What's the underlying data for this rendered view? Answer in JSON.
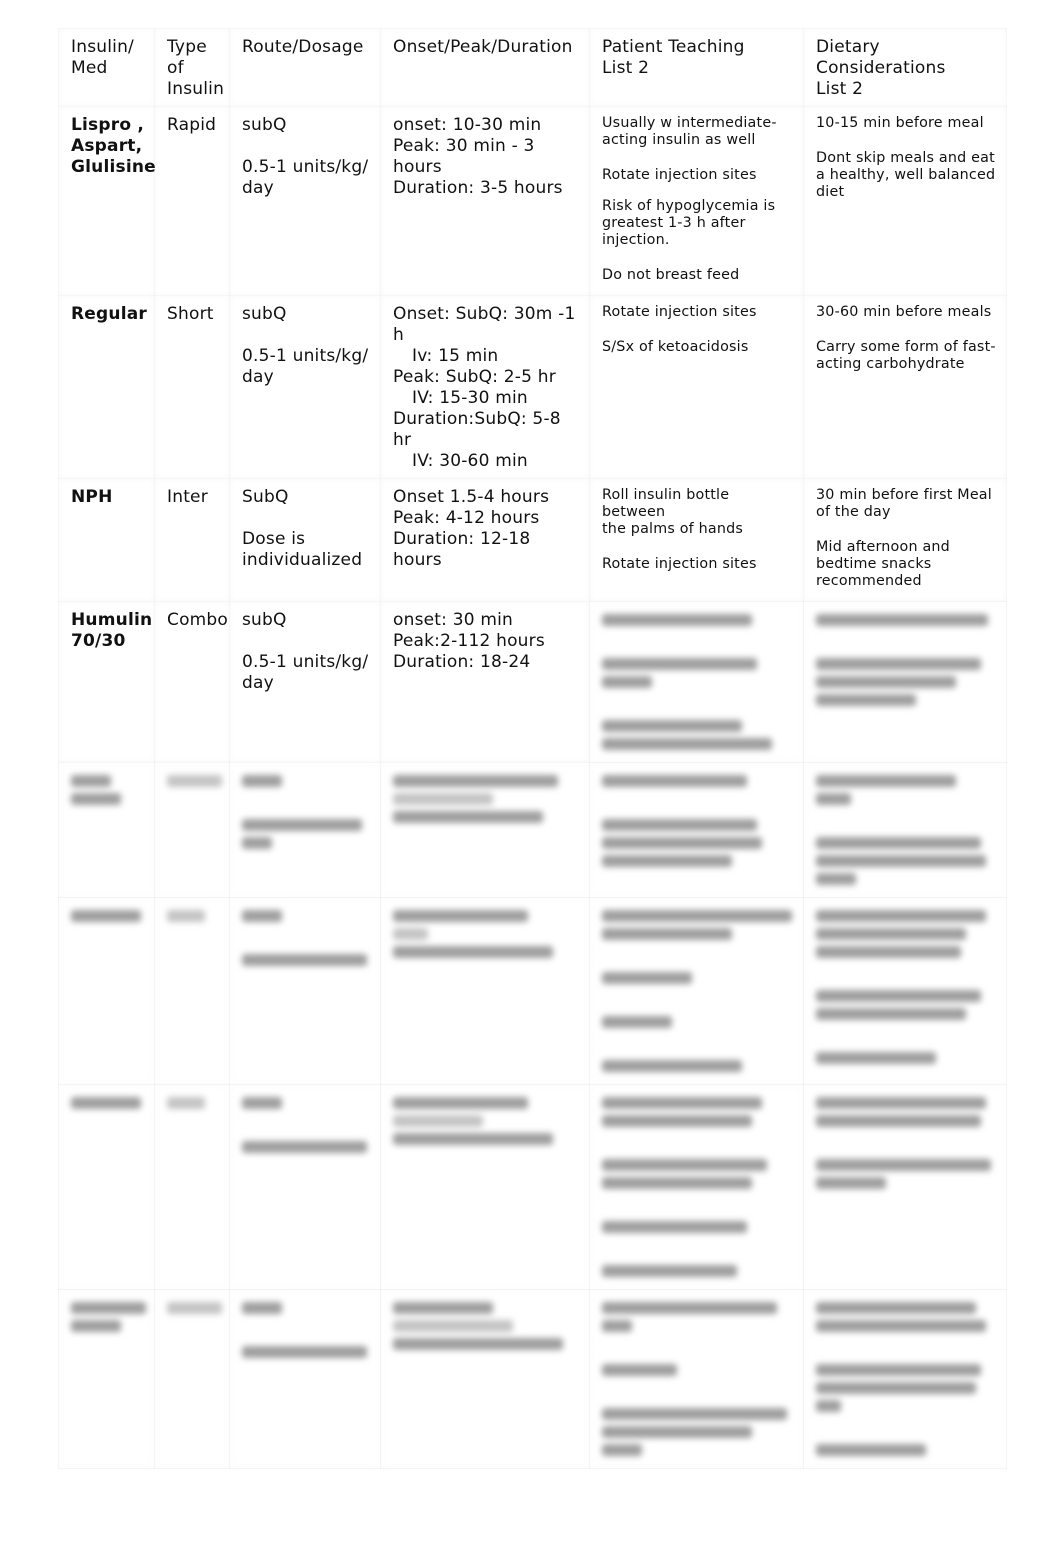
{
  "table": {
    "headers": {
      "col1": [
        "Insulin/",
        "Med"
      ],
      "col2": [
        "Type",
        "of",
        "Insulin"
      ],
      "col3": "Route/Dosage",
      "col4": "Onset/Peak/Duration",
      "col5": [
        "Patient Teaching",
        "List 2"
      ],
      "col6": [
        "Dietary",
        "Considerations",
        "List 2"
      ]
    },
    "rows": [
      {
        "med": [
          "Lispro ,",
          "Aspart,",
          "Glulisine"
        ],
        "type": "Rapid",
        "route": "subQ",
        "dosage": [
          "0.5-1 units/kg/",
          "day"
        ],
        "timing": [
          "onset: 10-30 min",
          "Peak: 30 min - 3 hours",
          "Duration: 3-5 hours"
        ],
        "teaching": [
          [
            "Usually w intermediate-",
            "acting insulin as well"
          ],
          [
            "Rotate injection sites"
          ],
          [
            "Risk of hypoglycemia is",
            "greatest 1-3 h after",
            "injection."
          ],
          [
            "Do not breast feed"
          ]
        ],
        "dietary": [
          [
            "10-15 min before meal"
          ],
          [
            "Dont skip meals and eat",
            "a healthy, well balanced",
            "diet"
          ]
        ]
      },
      {
        "med": [
          "Regular"
        ],
        "type": "Short",
        "route": "subQ",
        "dosage": [
          "0.5-1 units/kg/",
          "day"
        ],
        "timing": [
          "Onset: SubQ: 30m -1 h",
          "Iv: 15 min",
          "Peak: SubQ: 2-5 hr",
          "IV: 15-30 min",
          "Duration:SubQ: 5-8 hr",
          "IV: 30-60 min"
        ],
        "teaching": [
          [
            "Rotate injection sites"
          ],
          [
            "S/Sx of ketoacidosis"
          ]
        ],
        "dietary": [
          [
            "30-60 min before meals"
          ],
          [
            "Carry some form of fast-",
            "acting carbohydrate"
          ]
        ]
      },
      {
        "med": [
          "NPH"
        ],
        "type": "Inter",
        "route": "SubQ",
        "dosage": [
          "Dose is",
          "individualized"
        ],
        "timing": [
          "Onset 1.5-4 hours",
          "Peak: 4-12 hours",
          "Duration: 12-18 hours"
        ],
        "teaching": [
          [
            "Roll insulin bottle between",
            "the palms of hands"
          ],
          [
            "Rotate injection sites"
          ]
        ],
        "dietary": [
          [
            "30 min before first Meal",
            "of the day"
          ],
          [
            "Mid afternoon and",
            "bedtime snacks",
            "recommended"
          ]
        ]
      },
      {
        "med": [
          "Humulin",
          "70/30"
        ],
        "type": "Combo",
        "route": "subQ",
        "dosage": [
          "0.5-1 units/kg/",
          "day"
        ],
        "timing": [
          "onset: 30 min",
          "Peak:2-112 hours",
          "Duration: 18-24"
        ],
        "teaching_blurred": true,
        "dietary_blurred": true
      }
    ],
    "blurred_rows_count": 4
  }
}
